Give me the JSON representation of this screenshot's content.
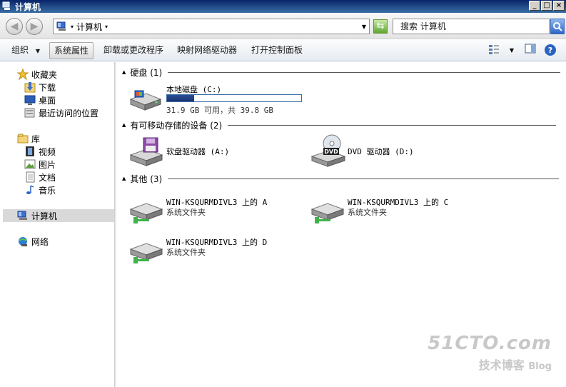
{
  "window": {
    "title": "计算机"
  },
  "address": {
    "crumb": "计算机",
    "search_placeholder": "搜索 计算机"
  },
  "toolbar": {
    "organize": "组织",
    "system_properties": "系统属性",
    "uninstall": "卸载或更改程序",
    "map_drive": "映射网络驱动器",
    "control_panel": "打开控制面板"
  },
  "nav": {
    "favorites": "收藏夹",
    "downloads": "下载",
    "desktop": "桌面",
    "recent": "最近访问的位置",
    "libraries": "库",
    "videos": "视频",
    "pictures": "图片",
    "documents": "文档",
    "music": "音乐",
    "computer": "计算机",
    "network": "网络"
  },
  "groups": {
    "hdd": "硬盘 (1)",
    "removable": "有可移动存储的设备 (2)",
    "other": "其他 (3)"
  },
  "drives": {
    "c": {
      "name": "本地磁盘 (C:)",
      "usage": "31.9 GB 可用，共 39.8 GB",
      "used_fraction": 0.2
    },
    "a": {
      "name": "软盘驱动器 (A:)"
    },
    "d": {
      "name": "DVD 驱动器 (D:)"
    }
  },
  "network_folders": [
    {
      "name": "WIN-KSQURMDIVL3 上的 A",
      "type": "系统文件夹"
    },
    {
      "name": "WIN-KSQURMDIVL3 上的 C",
      "type": "系统文件夹"
    },
    {
      "name": "WIN-KSQURMDIVL3 上的 D",
      "type": "系统文件夹"
    }
  ],
  "watermark": {
    "line1": "51CTO.com",
    "line2": "技术博客",
    "line3": "Blog"
  }
}
